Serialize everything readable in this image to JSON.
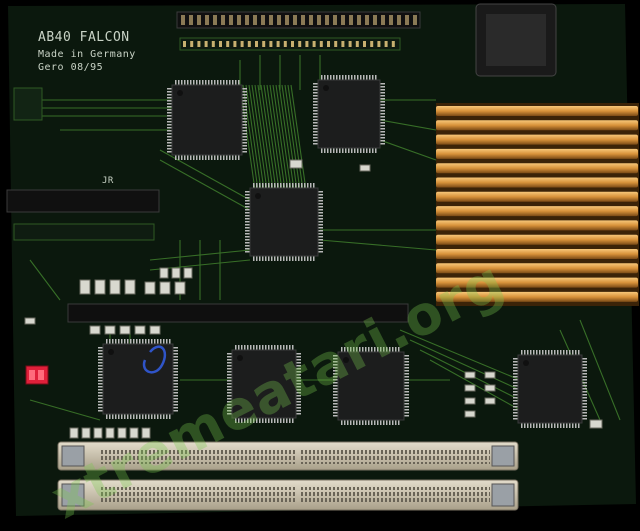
{
  "silkscreen": {
    "title": "AB40 FALCON",
    "origin": "Made in Germany",
    "date": "Gero 08/95",
    "header_label": "JR"
  },
  "watermark": "xtremeatari.org",
  "colors": {
    "pcb": "#0b180d",
    "trace": "#3f7d2c",
    "chip": "#1c1d1d",
    "heatsink": "#d8923a",
    "slot": "#c9c1ab",
    "jumper": "#e0203a"
  }
}
